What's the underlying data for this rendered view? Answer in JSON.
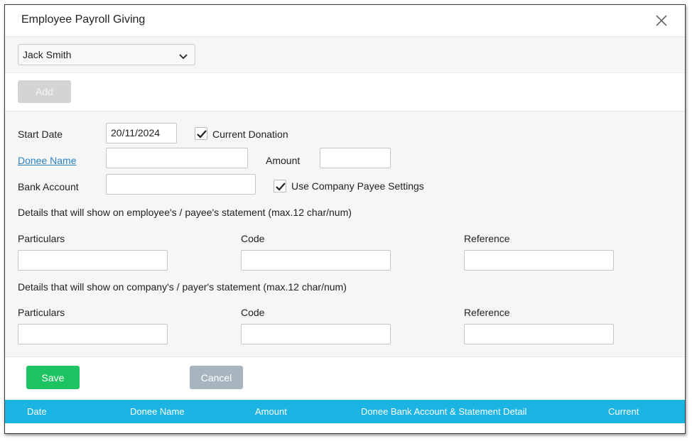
{
  "dialog": {
    "title": "Employee Payroll Giving",
    "close_icon": "close-icon"
  },
  "employee_select": {
    "value": "Jack Smith",
    "icon": "chevron-down-icon"
  },
  "toolbar": {
    "add_label": "Add"
  },
  "form": {
    "start_date_label": "Start Date",
    "start_date_value": "20/11/2024",
    "current_donation_label": "Current Donation",
    "current_donation_checked": true,
    "donee_name_label": "Donee Name",
    "donee_name_value": "",
    "amount_label": "Amount",
    "amount_value": "",
    "bank_account_label": "Bank Account",
    "bank_account_value": "",
    "use_company_payee_label": "Use Company Payee Settings",
    "use_company_payee_checked": true,
    "employee_statement_heading": "Details that will show on employee's / payee's statement (max.12 char/num)",
    "employee_particulars_label": "Particulars",
    "employee_code_label": "Code",
    "employee_reference_label": "Reference",
    "company_statement_heading": "Details that will show on company's / payer's statement (max.12 char/num)",
    "company_particulars_label": "Particulars",
    "company_code_label": "Code",
    "company_reference_label": "Reference"
  },
  "actions": {
    "save_label": "Save",
    "cancel_label": "Cancel"
  },
  "table": {
    "columns": [
      "Date",
      "Donee Name",
      "Amount",
      "Donee Bank Account & Statement Detail",
      "Current"
    ]
  },
  "colors": {
    "save": "#1fc462",
    "cancel": "#a7b5be",
    "table_header": "#1cb4e2",
    "link": "#2a84c6"
  }
}
